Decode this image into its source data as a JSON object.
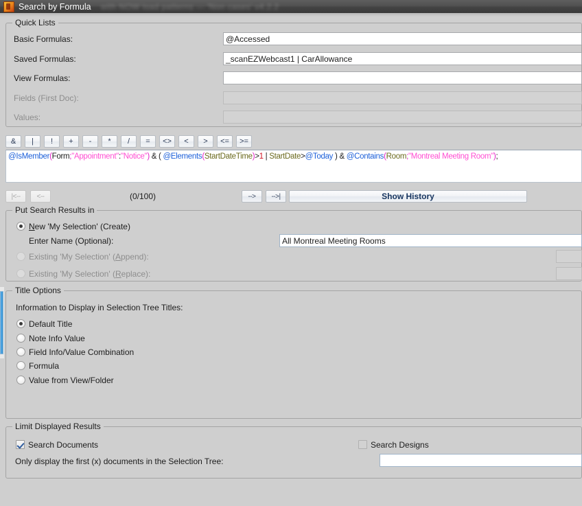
{
  "window": {
    "title": "Search by Formula",
    "blurred_suffix": "with NOW load patterns — 'Non cases' v4.2.2",
    "icon": "app-icon"
  },
  "quick_lists": {
    "caption": "Quick Lists",
    "rows": [
      {
        "label": "Basic Formulas:",
        "value": "@Accessed",
        "enabled": true
      },
      {
        "label": "Saved Formulas:",
        "value": "_scanEZWebcast1 | CarAllowance",
        "enabled": true
      },
      {
        "label": "View Formulas:",
        "value": "",
        "enabled": true
      },
      {
        "label": "Fields (First Doc):",
        "value": "",
        "enabled": false
      },
      {
        "label": "Values:",
        "value": "",
        "enabled": false
      }
    ]
  },
  "operators": [
    "&",
    "|",
    "!",
    "+",
    "-",
    "*",
    "/",
    "=",
    "<>",
    "<",
    ">",
    "<=",
    ">="
  ],
  "formula": {
    "raw": "@IsMember(Form;\"Appointment\":\"Notice\") & ( @Elements(StartDateTime)>1 | StartDate>@Today ) & @Contains(Room;\"Montreal Meeting Room\");",
    "tokens": [
      {
        "t": "@IsMember",
        "c": "fn"
      },
      {
        "t": "(",
        "c": "pn"
      },
      {
        "t": "Form",
        "c": "op"
      },
      {
        "t": ";",
        "c": "pn"
      },
      {
        "t": "\"Appointment\"",
        "c": "str"
      },
      {
        "t": ":",
        "c": "op"
      },
      {
        "t": "\"Notice\"",
        "c": "str"
      },
      {
        "t": ")",
        "c": "pn"
      },
      {
        "t": " & ( ",
        "c": "op"
      },
      {
        "t": "@Elements",
        "c": "fn"
      },
      {
        "t": "(",
        "c": "pn"
      },
      {
        "t": "StartDateTime",
        "c": "fld"
      },
      {
        "t": ")",
        "c": "pn"
      },
      {
        "t": ">",
        "c": "op"
      },
      {
        "t": "1",
        "c": "num"
      },
      {
        "t": " | ",
        "c": "op"
      },
      {
        "t": "StartDate",
        "c": "fld"
      },
      {
        "t": ">",
        "c": "op"
      },
      {
        "t": "@Today",
        "c": "fn"
      },
      {
        "t": " ) & ",
        "c": "op"
      },
      {
        "t": "@Contains",
        "c": "fn"
      },
      {
        "t": "(",
        "c": "pn"
      },
      {
        "t": "Room",
        "c": "fld"
      },
      {
        "t": ";",
        "c": "pn"
      },
      {
        "t": "\"Montreal Meeting Room\"",
        "c": "str"
      },
      {
        "t": ")",
        "c": "pn"
      },
      {
        "t": ";",
        "c": "op"
      }
    ]
  },
  "history_nav": {
    "first_label": "|<--",
    "prev_label": "<--",
    "counter": "(0/100)",
    "next_label": "-->",
    "last_label": "-->|",
    "show_history_label": "Show History"
  },
  "put_results": {
    "caption": "Put Search Results in",
    "options": [
      {
        "label_pre": "",
        "accel": "N",
        "label_post": "ew 'My Selection' (Create)",
        "selected": true,
        "enabled": true
      },
      {
        "label_pre": "Existing 'My Selection' (",
        "accel": "A",
        "label_post": "ppend):",
        "selected": false,
        "enabled": false
      },
      {
        "label_pre": "Existing 'My Selection' (",
        "accel": "R",
        "label_post": "eplace):",
        "selected": false,
        "enabled": false
      }
    ],
    "enter_name_label": "Enter Name (Optional):",
    "enter_name_value": "All Montreal Meeting Rooms"
  },
  "title_options": {
    "caption": "Title Options",
    "subtitle": "Information to Display in Selection Tree Titles:",
    "options": [
      {
        "label": "Default Title",
        "selected": true
      },
      {
        "label": "Note Info Value",
        "selected": false
      },
      {
        "label": "Field Info/Value Combination",
        "selected": false
      },
      {
        "label": "Formula",
        "selected": false
      },
      {
        "label": "Value from View/Folder",
        "selected": false
      }
    ]
  },
  "limit_results": {
    "caption": "Limit Displayed Results",
    "search_documents": {
      "label": "Search Documents",
      "checked": true
    },
    "search_designs": {
      "label": "Search Designs",
      "checked": false
    },
    "only_display_label": "Only display the first (x) documents in the Selection Tree:",
    "only_display_value": ""
  },
  "colors": {
    "window_bg": "#cfcfcf",
    "titlebar": "#444444",
    "accent_blue": "#1b5fd9",
    "string_pink": "#ff4fd2",
    "field_olive": "#6b6a1e",
    "number_red": "#d01020",
    "scrollbar_blue": "#3c9ade"
  }
}
